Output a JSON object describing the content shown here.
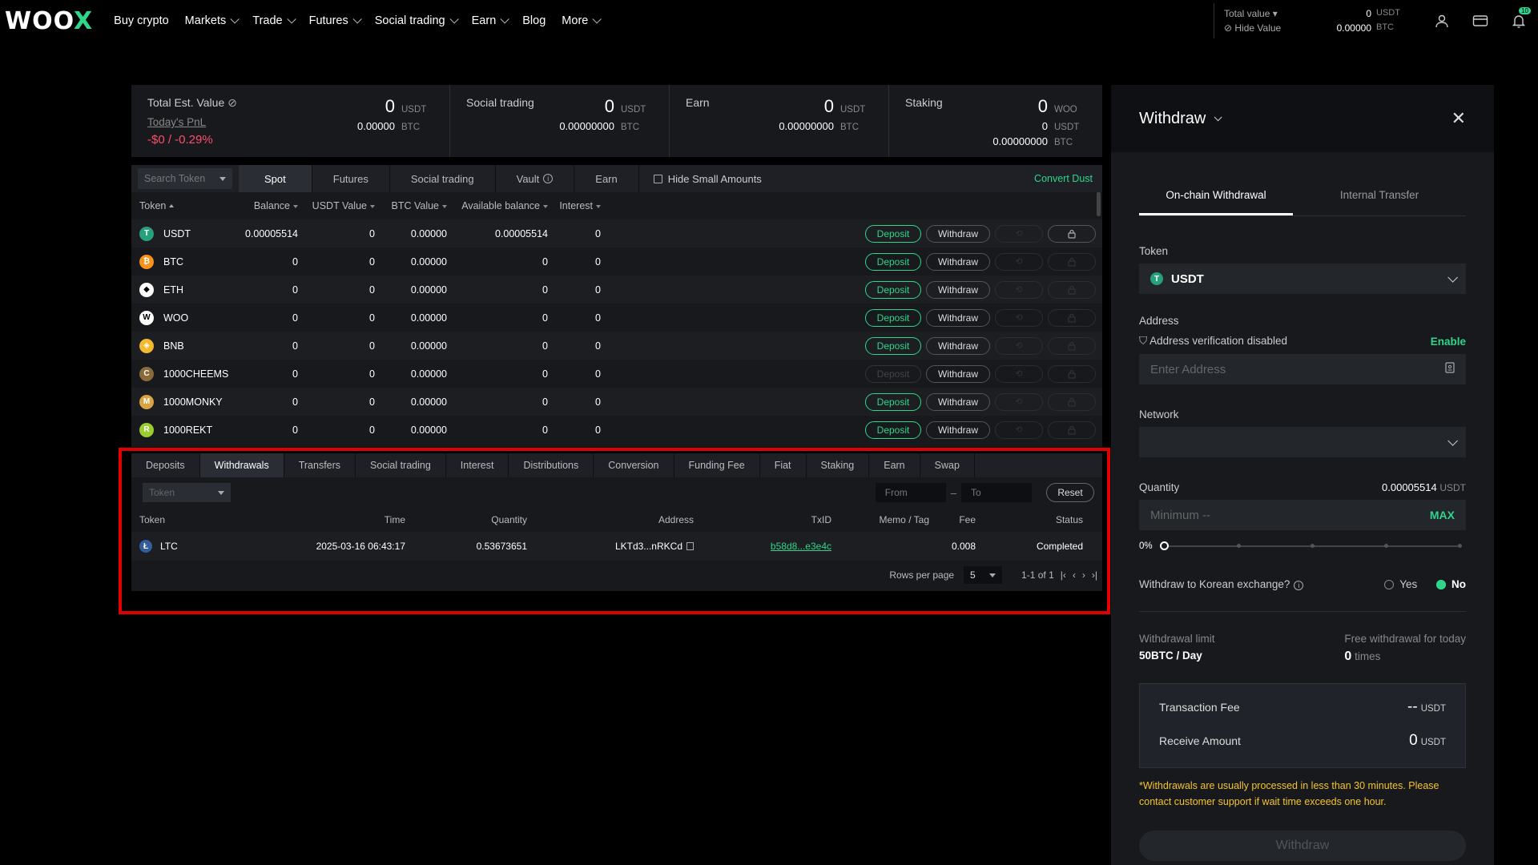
{
  "colors": {
    "accent": "#2fd58b",
    "negative": "#ff4d6a",
    "warning": "#f4c42c",
    "highlight_box": "#e00000"
  },
  "nav": {
    "logo_main": "WOO",
    "logo_x": "X",
    "items": [
      {
        "label": "Buy crypto",
        "dropdown": false
      },
      {
        "label": "Markets",
        "dropdown": true
      },
      {
        "label": "Trade",
        "dropdown": true
      },
      {
        "label": "Futures",
        "dropdown": true
      },
      {
        "label": "Social trading",
        "dropdown": true
      },
      {
        "label": "Earn",
        "dropdown": true
      },
      {
        "label": "Blog",
        "dropdown": false
      },
      {
        "label": "More",
        "dropdown": true
      }
    ],
    "total_value_label": "Total value",
    "total_value": "0",
    "total_value_unit": "USDT",
    "hide_value_label": "Hide Value",
    "total_btc": "0.00000",
    "total_btc_unit": "BTC",
    "notif_count": "10",
    "icons": [
      "user-icon",
      "wallet-icon",
      "bell-icon"
    ]
  },
  "summary": {
    "total_est": {
      "label": "Total Est. Value",
      "pnl_link": "Today's PnL",
      "pnl": "-$0 / -0.29%",
      "usdt": "0",
      "usdt_unit": "USDT",
      "btc": "0.00000",
      "btc_unit": "BTC"
    },
    "social": {
      "label": "Social trading",
      "usdt": "0",
      "usdt_unit": "USDT",
      "btc": "0.00000000",
      "btc_unit": "BTC"
    },
    "earn": {
      "label": "Earn",
      "usdt": "0",
      "usdt_unit": "USDT",
      "btc": "0.00000000",
      "btc_unit": "BTC"
    },
    "staking": {
      "label": "Staking",
      "woo": "0",
      "woo_unit": "WOO",
      "usdt": "0",
      "usdt_unit": "USDT",
      "btc": "0.00000000",
      "btc_unit": "BTC"
    }
  },
  "tokens": {
    "search_placeholder": "Search Token",
    "tabs": [
      "Spot",
      "Futures",
      "Social trading",
      "Vault",
      "Earn"
    ],
    "active_tab": "Spot",
    "hide_small": "Hide Small Amounts",
    "convert_dust": "Convert Dust",
    "columns": [
      "Token",
      "Balance",
      "USDT Value",
      "BTC Value",
      "Available balance",
      "Interest"
    ],
    "deposit_label": "Deposit",
    "withdraw_label": "Withdraw",
    "rows": [
      {
        "token": "USDT",
        "balance": "0.00005514",
        "usdt": "0",
        "btc": "0.00000",
        "avail": "0.00005514",
        "interest": "0",
        "color": "#26a17b",
        "glyph": "T",
        "deposit_enabled": true
      },
      {
        "token": "BTC",
        "balance": "0",
        "usdt": "0",
        "btc": "0.00000",
        "avail": "0",
        "interest": "0",
        "color": "#f7931a",
        "glyph": "₿",
        "deposit_enabled": true
      },
      {
        "token": "ETH",
        "balance": "0",
        "usdt": "0",
        "btc": "0.00000",
        "avail": "0",
        "interest": "0",
        "color": "#ffffff",
        "glyph": "◆",
        "deposit_enabled": true
      },
      {
        "token": "WOO",
        "balance": "0",
        "usdt": "0",
        "btc": "0.00000",
        "avail": "0",
        "interest": "0",
        "color": "#ffffff",
        "glyph": "W",
        "deposit_enabled": true
      },
      {
        "token": "BNB",
        "balance": "0",
        "usdt": "0",
        "btc": "0.00000",
        "avail": "0",
        "interest": "0",
        "color": "#f3ba2f",
        "glyph": "◈",
        "deposit_enabled": true
      },
      {
        "token": "1000CHEEMS",
        "balance": "0",
        "usdt": "0",
        "btc": "0.00000",
        "avail": "0",
        "interest": "0",
        "color": "#8a6a3a",
        "glyph": "C",
        "deposit_enabled": false
      },
      {
        "token": "1000MONKY",
        "balance": "0",
        "usdt": "0",
        "btc": "0.00000",
        "avail": "0",
        "interest": "0",
        "color": "#d9a441",
        "glyph": "M",
        "deposit_enabled": true
      },
      {
        "token": "1000REKT",
        "balance": "0",
        "usdt": "0",
        "btc": "0.00000",
        "avail": "0",
        "interest": "0",
        "color": "#9acd32",
        "glyph": "R",
        "deposit_enabled": true
      }
    ]
  },
  "history": {
    "tabs": [
      "Deposits",
      "Withdrawals",
      "Transfers",
      "Social trading",
      "Interest",
      "Distributions",
      "Conversion",
      "Funding Fee",
      "Fiat",
      "Staking",
      "Earn",
      "Swap"
    ],
    "active_tab": "Withdrawals",
    "token_placeholder": "Token",
    "from_placeholder": "From",
    "to_placeholder": "To",
    "reset": "Reset",
    "columns": {
      "token": "Token",
      "time": "Time",
      "quantity": "Quantity",
      "address": "Address",
      "txid": "TxID",
      "memo": "Memo / Tag",
      "fee": "Fee",
      "status": "Status"
    },
    "rows": [
      {
        "token": "LTC",
        "time": "2025-03-16 06:43:17",
        "quantity": "0.53673651",
        "address": "LKTd3...nRKCd",
        "txid": "b58d8...e3e4c",
        "memo": "",
        "fee": "0.008",
        "status": "Completed"
      }
    ],
    "rows_per_page_label": "Rows per page",
    "rows_per_page": "5",
    "page_info": "1-1 of 1"
  },
  "withdraw": {
    "title": "Withdraw",
    "tabs": [
      "On-chain Withdrawal",
      "Internal Transfer"
    ],
    "token_label": "Token",
    "token_value": "USDT",
    "address_label": "Address",
    "address_verify": "Address verification disabled",
    "enable": "Enable",
    "address_placeholder": "Enter Address",
    "network_label": "Network",
    "quantity_label": "Quantity",
    "quantity_avail": "0.00005514",
    "quantity_unit": "USDT",
    "quantity_placeholder": "Minimum --",
    "max": "MAX",
    "slider_pct": "0%",
    "slider_value": 0,
    "korean_q": "Withdraw to Korean exchange?",
    "yes": "Yes",
    "no": "No",
    "korean_selected": "No",
    "limit_label": "Withdrawal limit",
    "limit_value": "50BTC / Day",
    "free_label": "Free withdrawal for today",
    "free_value": "0",
    "free_unit": "times",
    "fee_label": "Transaction Fee",
    "fee_value": "--",
    "fee_unit": "USDT",
    "receive_label": "Receive Amount",
    "receive_value": "0",
    "receive_unit": "USDT",
    "note": "*Withdrawals are usually processed in less than 30 minutes. Please contact customer support if wait time exceeds one hour.",
    "button": "Withdraw"
  }
}
